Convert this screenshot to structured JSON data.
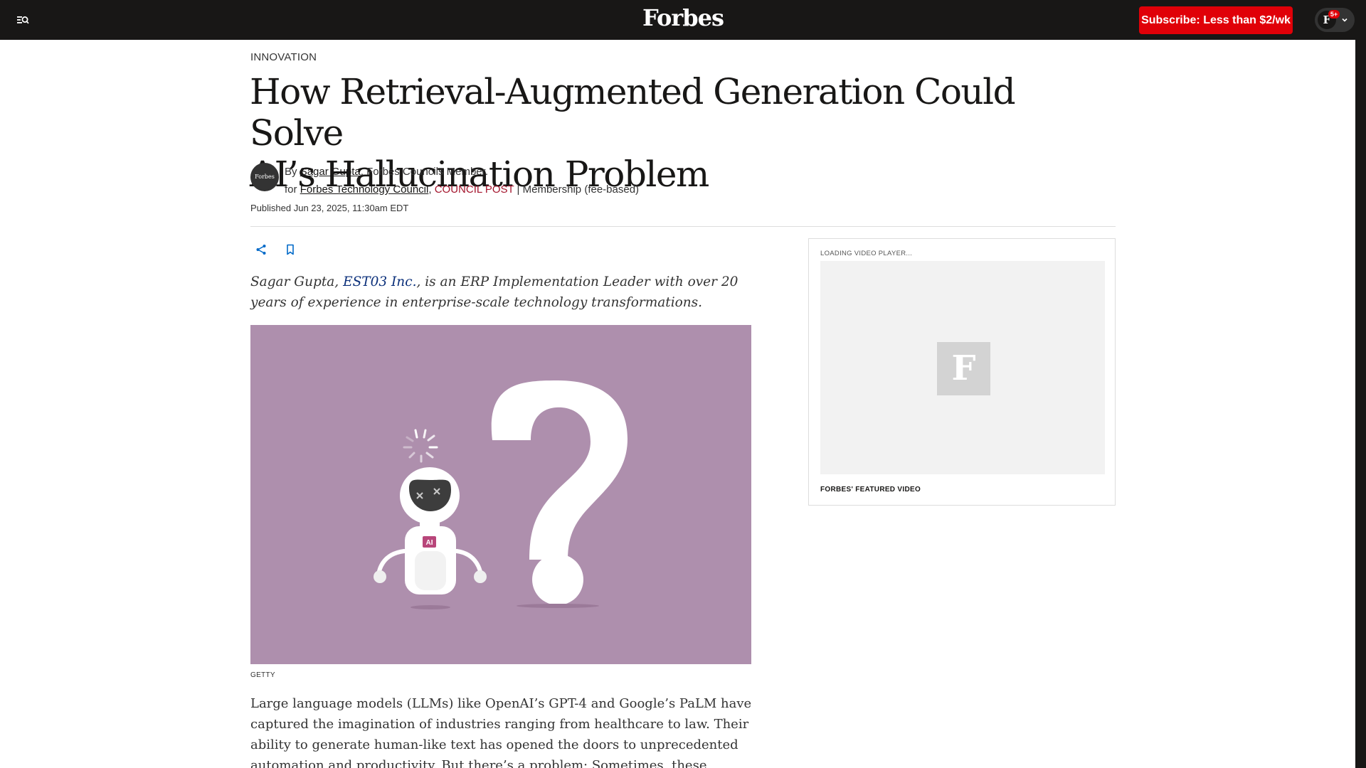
{
  "header": {
    "logo": "Forbes",
    "subscribe_label": "Subscribe: Less than $2/wk",
    "account_initial": "F",
    "notification_count": "5+"
  },
  "article": {
    "section": "INNOVATION",
    "headline_line1": "How Retrieval-Augmented Generation Could Solve",
    "headline_line2": "AI’s Hallucination Problem",
    "avatar_text": "Forbes",
    "byline": {
      "by": "By",
      "author": "Sagar Gupta",
      "author_role": ", Forbes Councils Member.",
      "for": "for",
      "council": "Forbes Technology Council",
      "post_type": "COUNCIL POST",
      "membership": " | Membership (fee-based)"
    },
    "published": "Published Jun 23, 2025, 11:30am EDT",
    "intro_pre": "Sagar Gupta, ",
    "intro_link": "EST03 Inc.",
    "intro_post": ", is an ERP Implementation Leader with over 20 years of experience in enterprise-scale technology transformations.",
    "image_badge": "AI",
    "image_credit": "GETTY",
    "body": "Large language models (LLMs) like OpenAI’s GPT-4 and Google’s PaLM have captured the imagination of industries ranging from healthcare to law. Their ability to generate human-like text has opened the doors to unprecedented automation and productivity. But there’s a problem: Sometimes, these models make things up. This phenomenon—"
  },
  "video": {
    "loading": "LOADING VIDEO PLAYER...",
    "logo": "F",
    "title": "FORBES' FEATURED VIDEO"
  },
  "colors": {
    "topbar": "#181716",
    "subscribe": "#e00008",
    "hero_background": "#ae8fad",
    "council_post": "#a4152d",
    "link": "#0a2f7a"
  }
}
